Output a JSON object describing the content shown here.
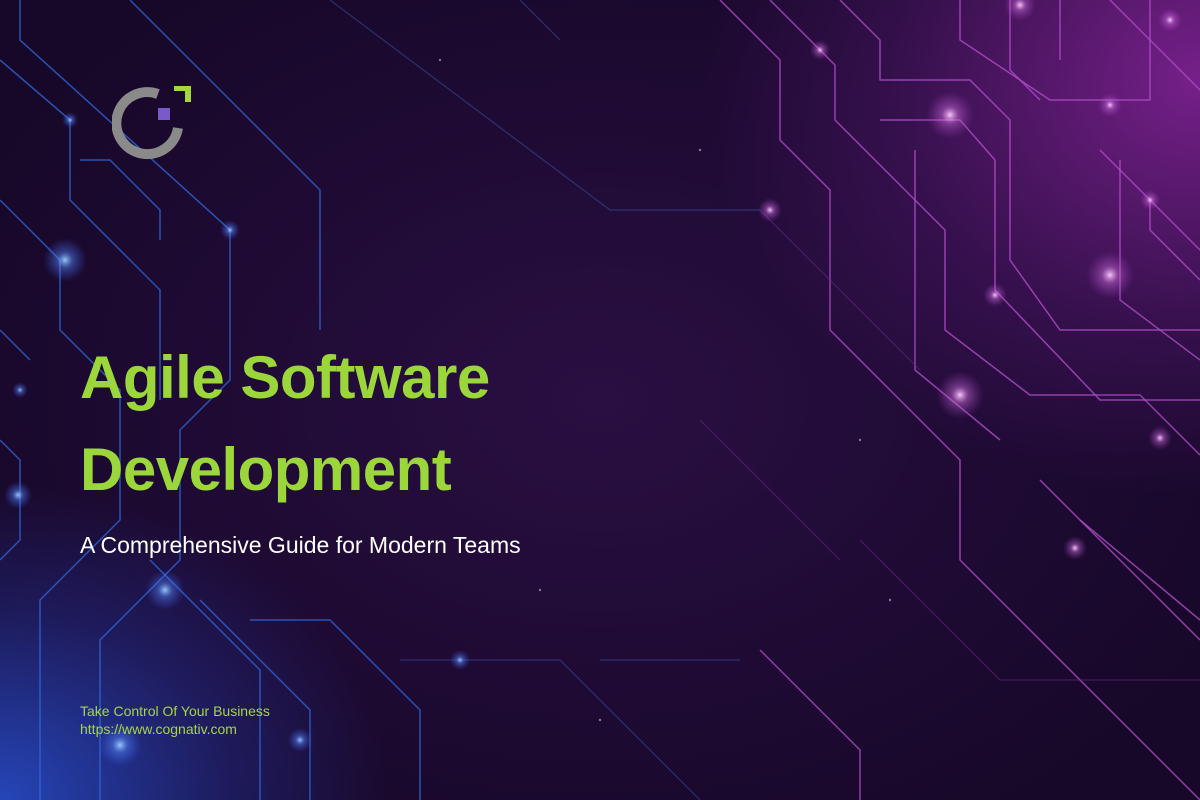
{
  "title": {
    "line1": "Agile Software",
    "line2": "Development"
  },
  "subtitle": "A Comprehensive Guide for Modern Teams",
  "footer": {
    "tagline": "Take Control Of Your Business",
    "url": "https://www.cognativ.com"
  },
  "logo": {
    "icon": "brand-logo-icon"
  },
  "colors": {
    "title": "#9bd63a",
    "subtitle": "#ffffff",
    "footer": "#a6d640",
    "circuit_left": "#2f6be0",
    "circuit_right": "#b04cc8",
    "logo_arc": "#8a8a8a",
    "logo_corner": "#a6d640",
    "logo_square": "#7a5ac8"
  }
}
